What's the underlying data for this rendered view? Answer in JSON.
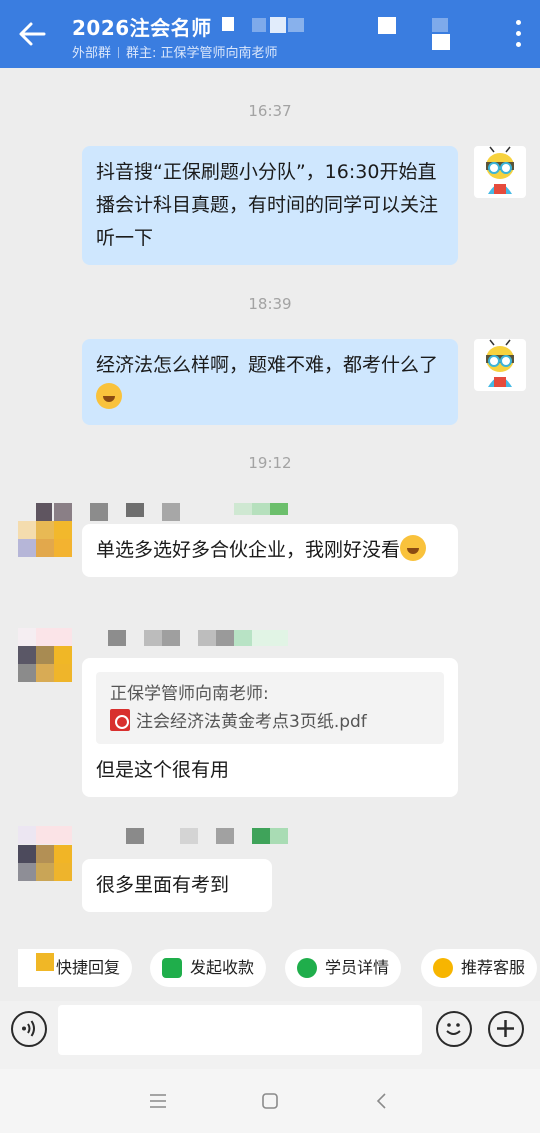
{
  "header": {
    "title": "2026注会名师",
    "group_type": "外部群",
    "group_owner": "群主: 正保学管师向南老师"
  },
  "messages": [
    {
      "time": "16:37"
    },
    {
      "text": "抖音搜“正保刷题小分队”，16:30开始直播会计科目真题，有时间的同学可以关注听一下"
    },
    {
      "time": "18:39"
    },
    {
      "text": "经济法怎么样啊，题难不难，都考什么了"
    },
    {
      "time": "19:12"
    },
    {
      "text": "单选多选好多合伙企业，我刚好没看"
    },
    {
      "quote_author": "正保学管师向南老师:",
      "quote_file": "注会经济法黄金考点3页纸.pdf",
      "text": "但是这个很有用"
    },
    {
      "text": "很多里面有考到"
    }
  ],
  "quick_actions": {
    "quick_reply": "快捷回复",
    "collect_payment": "发起收款",
    "student_details": "学员详情",
    "recommend_service": "推荐客服"
  },
  "colors": {
    "header": "#3a7de0",
    "my_bubble": "#cfe7fe",
    "their_bubble": "#ffffff"
  }
}
